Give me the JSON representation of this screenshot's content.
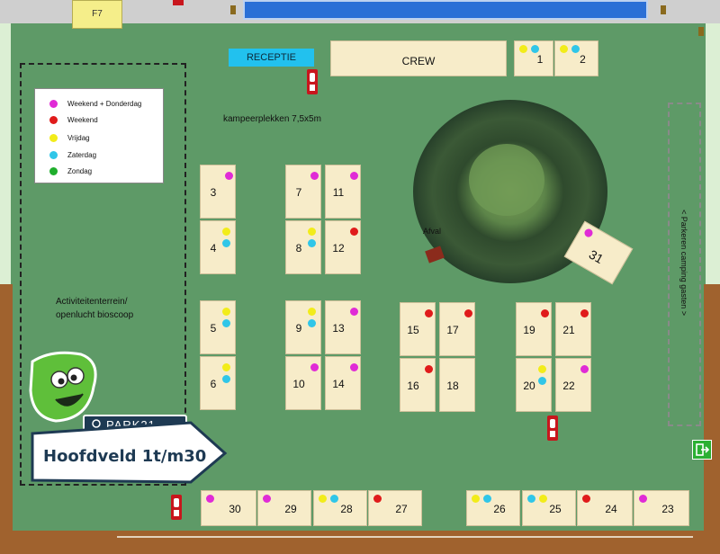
{
  "map": {
    "f7_label": "F7",
    "reception_label": "RECEPTIE",
    "crew_label": "CREW",
    "camping_plots_note": "kampeerplekken 7,5x5m",
    "activity_area_line1": "Activiteitenterrein/",
    "activity_area_line2": "openlucht bioscoop",
    "waste_label": "Afval",
    "parking_label": "< Parkeren camping gasten >",
    "brand": "PARK21",
    "sign_title": "Hoofdveld 1t/m30"
  },
  "colors": {
    "weekend_donderdag": "#e02bd6",
    "weekend": "#e01b1b",
    "vrijdag": "#f2ec1a",
    "zaterdag": "#30c6e8",
    "zondag": "#1fae2c"
  },
  "legend": [
    {
      "label": "Weekend + Donderdag",
      "color_key": "weekend_donderdag"
    },
    {
      "label": "Weekend",
      "color_key": "weekend"
    },
    {
      "label": "Vrijdag",
      "color_key": "vrijdag"
    },
    {
      "label": "Zaterdag",
      "color_key": "zaterdag"
    },
    {
      "label": "Zondag",
      "color_key": "zondag"
    }
  ],
  "plots": [
    {
      "number": "1",
      "days": [
        "vrijdag",
        "zaterdag"
      ]
    },
    {
      "number": "2",
      "days": [
        "vrijdag",
        "zaterdag"
      ]
    },
    {
      "number": "3",
      "days": [
        "weekend_donderdag"
      ]
    },
    {
      "number": "4",
      "days": [
        "vrijdag",
        "zaterdag"
      ]
    },
    {
      "number": "5",
      "days": [
        "vrijdag",
        "zaterdag"
      ]
    },
    {
      "number": "6",
      "days": [
        "vrijdag",
        "zaterdag"
      ]
    },
    {
      "number": "7",
      "days": [
        "weekend_donderdag"
      ]
    },
    {
      "number": "8",
      "days": [
        "vrijdag",
        "zaterdag"
      ]
    },
    {
      "number": "9",
      "days": [
        "vrijdag",
        "zaterdag"
      ]
    },
    {
      "number": "10",
      "days": [
        "weekend_donderdag"
      ]
    },
    {
      "number": "11",
      "days": [
        "weekend_donderdag"
      ]
    },
    {
      "number": "12",
      "days": [
        "weekend"
      ]
    },
    {
      "number": "13",
      "days": [
        "weekend_donderdag"
      ]
    },
    {
      "number": "14",
      "days": [
        "weekend_donderdag"
      ]
    },
    {
      "number": "15",
      "days": [
        "weekend"
      ]
    },
    {
      "number": "16",
      "days": [
        "weekend"
      ]
    },
    {
      "number": "17",
      "days": [
        "weekend"
      ]
    },
    {
      "number": "18",
      "days": []
    },
    {
      "number": "19",
      "days": [
        "weekend"
      ]
    },
    {
      "number": "20",
      "days": [
        "vrijdag",
        "zaterdag"
      ]
    },
    {
      "number": "21",
      "days": [
        "weekend"
      ]
    },
    {
      "number": "22",
      "days": [
        "weekend_donderdag"
      ]
    },
    {
      "number": "23",
      "days": [
        "weekend_donderdag"
      ]
    },
    {
      "number": "24",
      "days": [
        "weekend"
      ]
    },
    {
      "number": "25",
      "days": [
        "zaterdag",
        "vrijdag"
      ]
    },
    {
      "number": "26",
      "days": [
        "vrijdag",
        "zaterdag"
      ]
    },
    {
      "number": "27",
      "days": [
        "weekend"
      ]
    },
    {
      "number": "28",
      "days": [
        "vrijdag",
        "zaterdag"
      ]
    },
    {
      "number": "29",
      "days": [
        "weekend_donderdag"
      ]
    },
    {
      "number": "30",
      "days": [
        "weekend_donderdag"
      ]
    },
    {
      "number": "31",
      "days": [
        "weekend_donderdag"
      ]
    }
  ]
}
